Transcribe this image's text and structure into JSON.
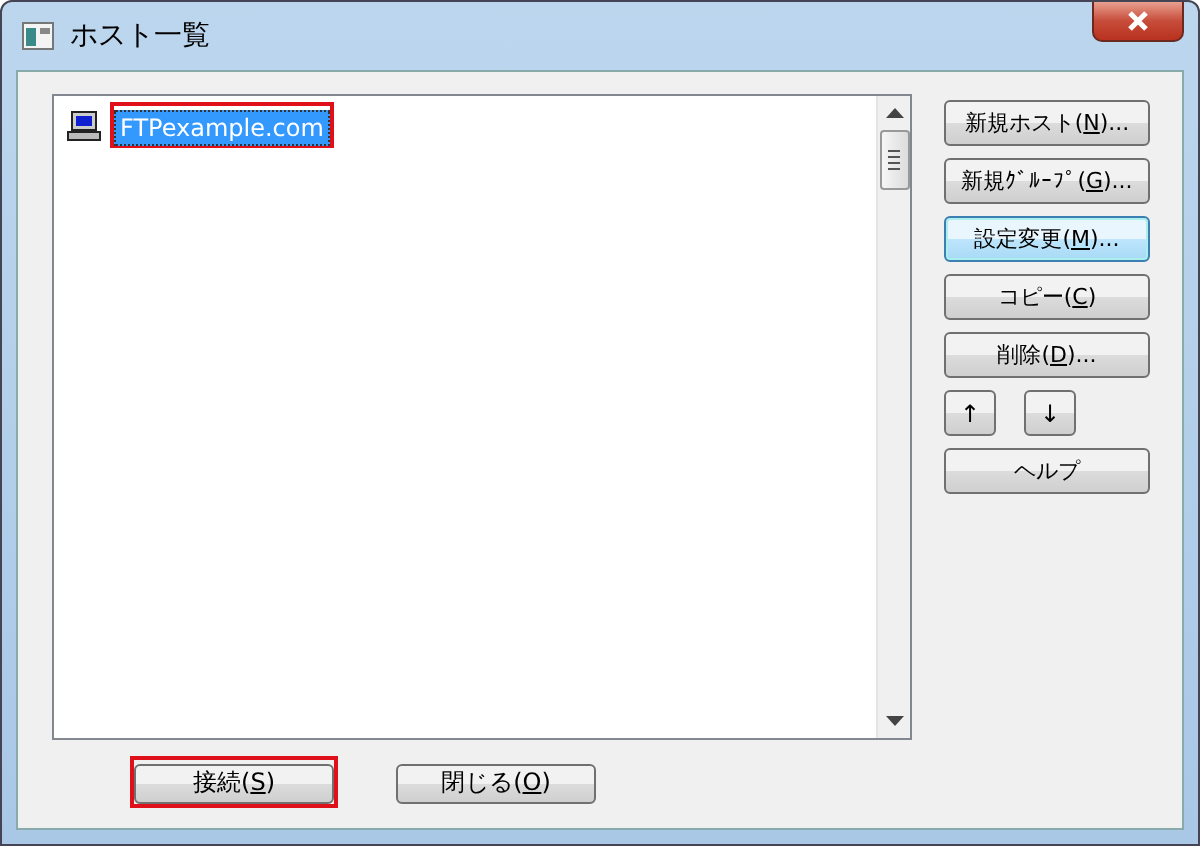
{
  "window": {
    "title": "ホスト一覧"
  },
  "host_list": {
    "items": [
      {
        "label": "FTPexample.com",
        "selected": true,
        "highlighted": true
      }
    ]
  },
  "side_buttons": [
    {
      "kind": "wide",
      "before": "新規ホスト(",
      "key": "N",
      "after": ")...",
      "focused": false
    },
    {
      "kind": "wide",
      "before": "新規ｸﾞﾙｰﾌﾟ(",
      "key": "G",
      "after": ")...",
      "focused": false
    },
    {
      "kind": "wide",
      "before": "設定変更(",
      "key": "M",
      "after": ")...",
      "focused": true
    },
    {
      "kind": "wide",
      "before": "コピー(",
      "key": "C",
      "after": ")",
      "focused": false
    },
    {
      "kind": "wide",
      "before": "削除(",
      "key": "D",
      "after": ")...",
      "focused": false
    },
    {
      "kind": "small",
      "before": "↑",
      "focused": false
    },
    {
      "kind": "small",
      "before": "↓",
      "focused": false
    },
    {
      "kind": "wide",
      "before": "ヘルプ",
      "focused": false
    }
  ],
  "bottom_buttons": [
    {
      "before": "接続(",
      "key": "S",
      "after": ")",
      "highlighted": true
    },
    {
      "before": "閉じる(",
      "key": "O",
      "after": ")",
      "highlighted": false
    }
  ]
}
